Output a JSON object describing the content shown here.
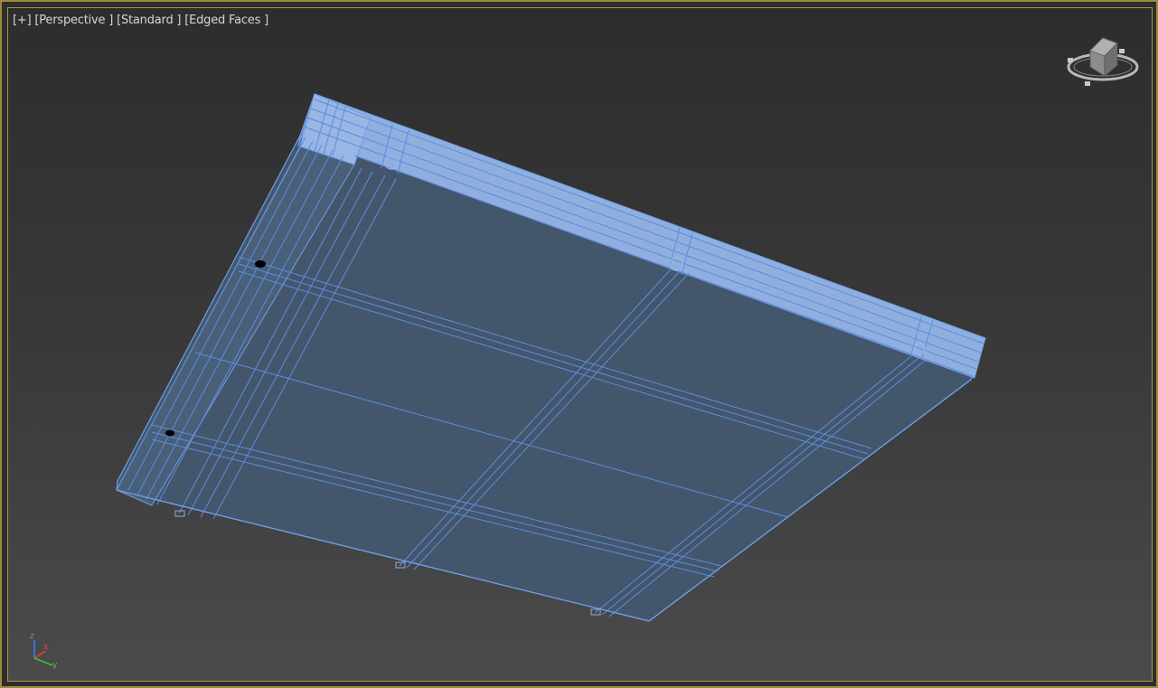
{
  "viewport": {
    "labels": {
      "plus": "[+]",
      "view": "[Perspective ]",
      "shading_style": "[Standard ]",
      "display_mode": "[Edged Faces ]"
    }
  },
  "viewcube": {
    "icon": "viewcube-icon"
  },
  "axis_tripod": {
    "z_label": "z",
    "x_label": "x",
    "y_label": "y"
  },
  "colors": {
    "frame": "#a9944a",
    "model_face": "#44566b",
    "model_top": "#8eaee0",
    "wire": "#6f9fe8",
    "label_text": "#d6d6d6"
  }
}
